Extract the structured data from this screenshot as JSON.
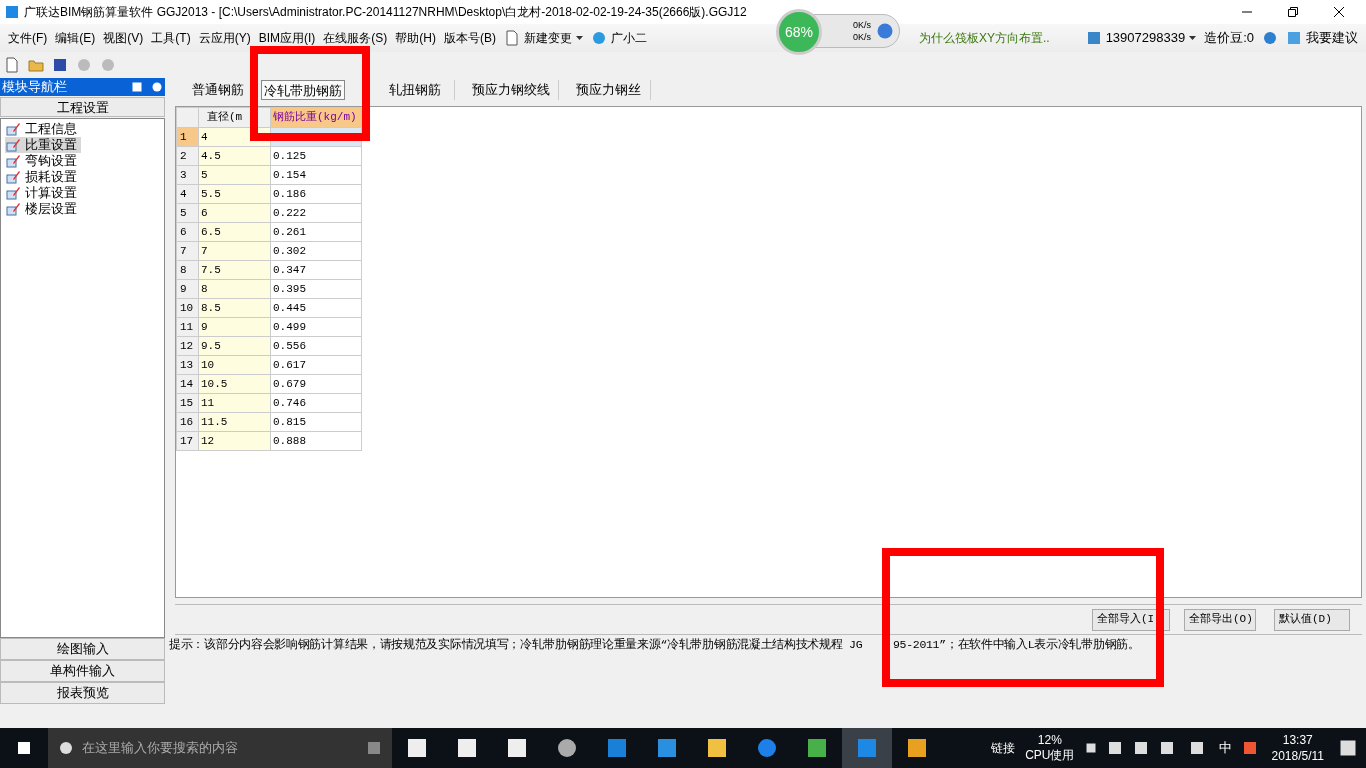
{
  "window": {
    "title": "广联达BIM钢筋算量软件 GGJ2013 - [C:\\Users\\Administrator.PC-20141127NRHM\\Desktop\\白龙村-2018-02-02-19-24-35(2666版).GGJ12"
  },
  "menu": [
    "文件(F)",
    "编辑(E)",
    "视图(V)",
    "工具(T)",
    "云应用(Y)",
    "BIM应用(I)",
    "在线服务(S)",
    "帮助(H)",
    "版本号(B)"
  ],
  "menu_extras": {
    "new_change": "新建变更",
    "assistant": "广小二",
    "question": "为什么筏板XY方向布置..",
    "account": "13907298339",
    "beans": "造价豆:0",
    "feedback": "我要建议"
  },
  "net_widget": {
    "percent": "68%",
    "up": "0K/s",
    "down": "0K/s"
  },
  "nav": {
    "title": "模块导航栏",
    "section": "工程设置",
    "items": [
      {
        "label": "工程信息",
        "selected": false
      },
      {
        "label": "比重设置",
        "selected": true
      },
      {
        "label": "弯钩设置",
        "selected": false
      },
      {
        "label": "损耗设置",
        "selected": false
      },
      {
        "label": "计算设置",
        "selected": false
      },
      {
        "label": "楼层设置",
        "selected": false
      }
    ],
    "bottom": [
      "绘图输入",
      "单构件输入",
      "报表预览"
    ]
  },
  "tabs": [
    {
      "label": "普通钢筋",
      "selected": false
    },
    {
      "label": "冷轧带肋钢筋",
      "selected": true
    },
    {
      "label": "轧扭钢筋",
      "selected": false
    },
    {
      "label": "预应力钢绞线",
      "selected": false
    },
    {
      "label": "预应力钢丝",
      "selected": false
    }
  ],
  "table": {
    "columns": [
      {
        "label": "直径(m",
        "selected": false
      },
      {
        "label": "钢筋比重(kg/m)",
        "selected": true
      }
    ],
    "rows": [
      {
        "n": "1",
        "d": "4",
        "w": "",
        "selected": true
      },
      {
        "n": "2",
        "d": "4.5",
        "w": "0.125",
        "selected": false
      },
      {
        "n": "3",
        "d": "5",
        "w": "0.154",
        "selected": false
      },
      {
        "n": "4",
        "d": "5.5",
        "w": "0.186",
        "selected": false
      },
      {
        "n": "5",
        "d": "6",
        "w": "0.222",
        "selected": false
      },
      {
        "n": "6",
        "d": "6.5",
        "w": "0.261",
        "selected": false
      },
      {
        "n": "7",
        "d": "7",
        "w": "0.302",
        "selected": false
      },
      {
        "n": "8",
        "d": "7.5",
        "w": "0.347",
        "selected": false
      },
      {
        "n": "9",
        "d": "8",
        "w": "0.395",
        "selected": false
      },
      {
        "n": "10",
        "d": "8.5",
        "w": "0.445",
        "selected": false
      },
      {
        "n": "11",
        "d": "9",
        "w": "0.499",
        "selected": false
      },
      {
        "n": "12",
        "d": "9.5",
        "w": "0.556",
        "selected": false
      },
      {
        "n": "13",
        "d": "10",
        "w": "0.617",
        "selected": false
      },
      {
        "n": "14",
        "d": "10.5",
        "w": "0.679",
        "selected": false
      },
      {
        "n": "15",
        "d": "11",
        "w": "0.746",
        "selected": false
      },
      {
        "n": "16",
        "d": "11.5",
        "w": "0.815",
        "selected": false
      },
      {
        "n": "17",
        "d": "12",
        "w": "0.888",
        "selected": false
      }
    ]
  },
  "buttons": [
    "全部导入(I",
    "全部导出(O)",
    "默认值(D)"
  ],
  "hint": [
    "提示：该部分内容会影响钢筋计算结果，请按规范及实际情况填写；冷轧带肋钢筋理论重量来源“冷轧带肋钢筋混凝土结构技术规程 JG",
    "95-2011”；在软件中输入L表示冷轧带肋钢筋。"
  ],
  "taskbar": {
    "search_placeholder": "在这里输入你要搜索的内容",
    "link": "链接",
    "cpu": "12%",
    "cpu_label": "CPU使用",
    "ime": "中",
    "time": "13:37",
    "date": "2018/5/11"
  }
}
